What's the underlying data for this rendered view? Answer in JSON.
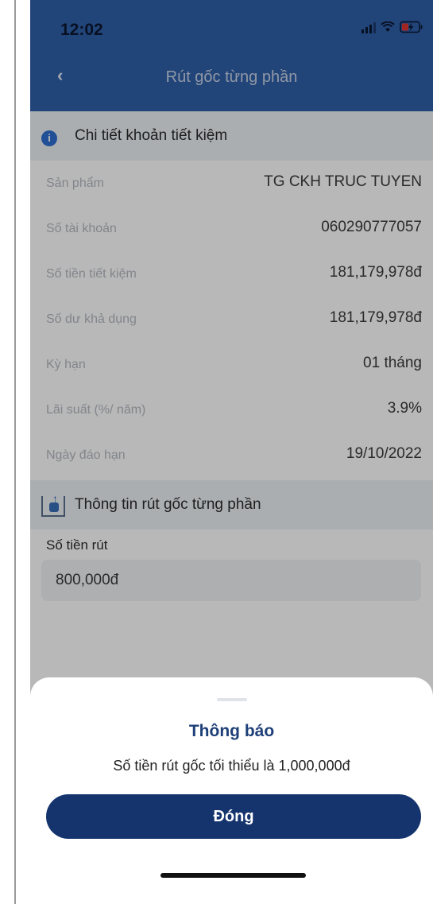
{
  "status_bar": {
    "time": "12:02"
  },
  "header": {
    "back_icon": "chevron-left-icon",
    "title": "Rút gốc từng phần"
  },
  "details": {
    "section_title": "Chi tiết khoản tiết kiệm",
    "rows": [
      {
        "label": "Sản phẩm",
        "value": "TG CKH TRUC TUYEN"
      },
      {
        "label": "Số tài khoản",
        "value": "060290777057"
      },
      {
        "label": "Số tiền tiết kiệm",
        "value": "181,179,978đ"
      },
      {
        "label": "Số dư khả dụng",
        "value": "181,179,978đ"
      },
      {
        "label": "Kỳ hạn",
        "value": "01 tháng"
      },
      {
        "label": "Lãi suất (%/ năm)",
        "value": "3.9%"
      },
      {
        "label": "Ngày đáo hạn",
        "value": "19/10/2022"
      }
    ]
  },
  "withdrawal": {
    "section_title": "Thông tin rút gốc từng phần",
    "amount_label": "Số tiền rút",
    "amount_value": "800,000đ"
  },
  "dialog": {
    "title": "Thông báo",
    "message": "Số tiền rút gốc tối thiểu là 1,000,000đ",
    "button_label": "Đóng"
  },
  "colors": {
    "header": "#2f5fa8",
    "button": "#15346e",
    "dialog_title": "#1e3f78"
  }
}
